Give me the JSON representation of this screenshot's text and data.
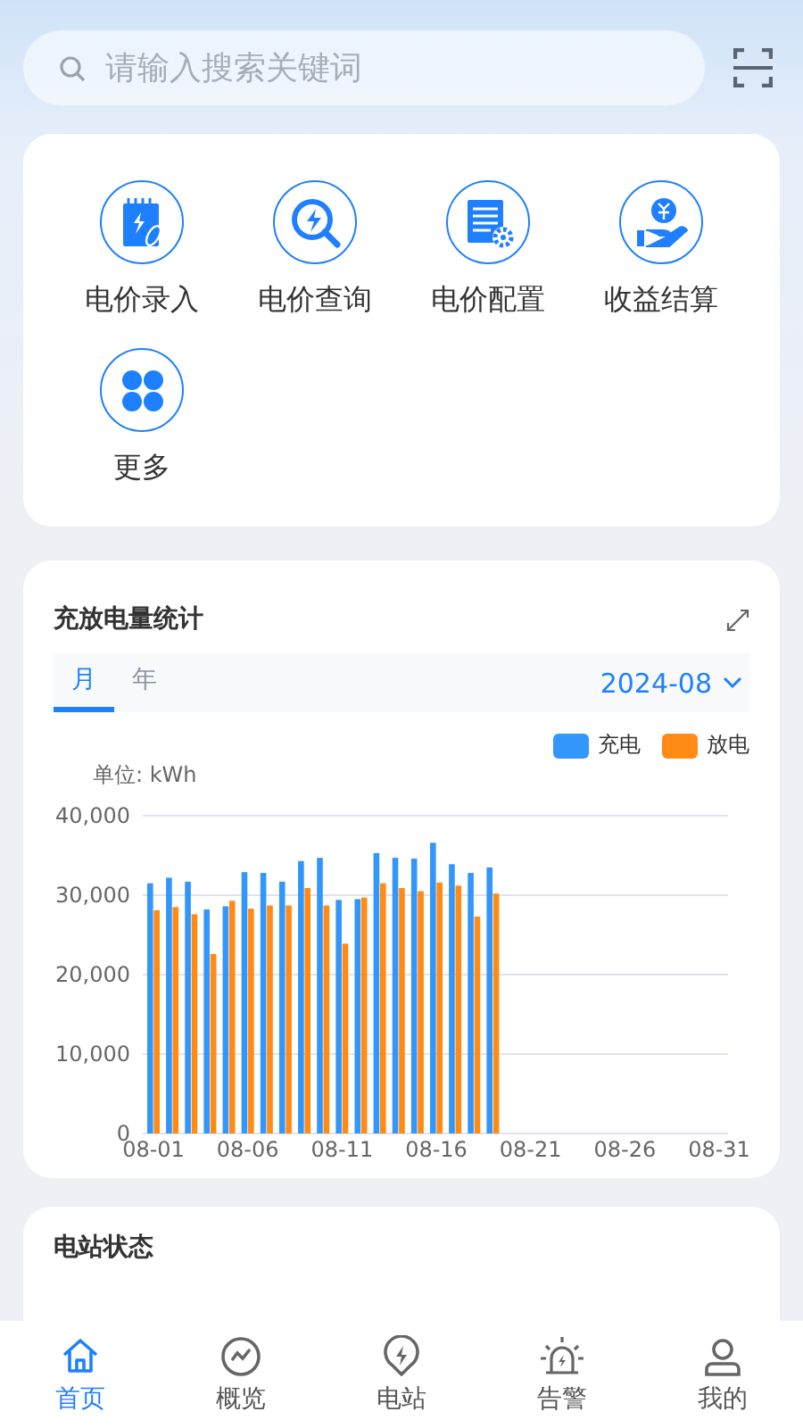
{
  "search": {
    "placeholder": "请输入搜索关键词"
  },
  "shortcuts": [
    {
      "label": "电价录入",
      "kind": "entry"
    },
    {
      "label": "电价查询",
      "kind": "query"
    },
    {
      "label": "电价配置",
      "kind": "config"
    },
    {
      "label": "收益结算",
      "kind": "income"
    },
    {
      "label": "更多",
      "kind": "more"
    }
  ],
  "stats_card": {
    "title": "充放电量统计",
    "tabs": [
      {
        "label": "月",
        "selected": true
      },
      {
        "label": "年",
        "selected": false
      }
    ],
    "period": "2024-08",
    "unit": "单位: kWh",
    "chart_data": {
      "type": "bar",
      "categories": [
        "08-01",
        null,
        null,
        null,
        null,
        "08-06",
        null,
        null,
        null,
        null,
        "08-11",
        null,
        null,
        null,
        null,
        "08-16",
        null,
        null,
        null,
        null,
        "08-21",
        null,
        null,
        null,
        null,
        "08-26",
        null,
        null,
        null,
        null,
        "08-31"
      ],
      "grid": true,
      "series": [
        {
          "name": "充电",
          "color": "#3296fa",
          "values": [
            31500,
            32200,
            31700,
            28200,
            28600,
            32900,
            32800,
            31700,
            34300,
            34700,
            29400,
            29500,
            35300,
            34700,
            34600,
            36600,
            33900,
            32800,
            33500,
            null,
            null,
            null,
            null,
            null,
            null,
            null,
            null,
            null,
            null,
            null,
            null
          ]
        },
        {
          "name": "放电",
          "color": "#ff8a14",
          "values": [
            28100,
            28500,
            27600,
            22600,
            29300,
            28300,
            28700,
            28700,
            30900,
            28700,
            23900,
            29700,
            31500,
            30900,
            30500,
            31600,
            31200,
            27300,
            30200,
            null,
            null,
            null,
            null,
            null,
            null,
            null,
            null,
            null,
            null,
            null,
            null
          ]
        }
      ],
      "ylim": [
        0,
        40000
      ],
      "yticks": [
        {
          "value": 0,
          "label": "0"
        },
        {
          "value": 10000,
          "label": "10,000"
        },
        {
          "value": 20000,
          "label": "20,000"
        },
        {
          "value": 30000,
          "label": "30,000"
        },
        {
          "value": 40000,
          "label": "40,000"
        }
      ]
    }
  },
  "status_card": {
    "title": "电站状态"
  },
  "bottom_nav": [
    {
      "label": "首页",
      "kind": "home",
      "selected": true
    },
    {
      "label": "概览",
      "kind": "overview",
      "selected": false
    },
    {
      "label": "电站",
      "kind": "station",
      "selected": false
    },
    {
      "label": "告警",
      "kind": "alarm",
      "selected": false
    },
    {
      "label": "我的",
      "kind": "me",
      "selected": false
    }
  ]
}
